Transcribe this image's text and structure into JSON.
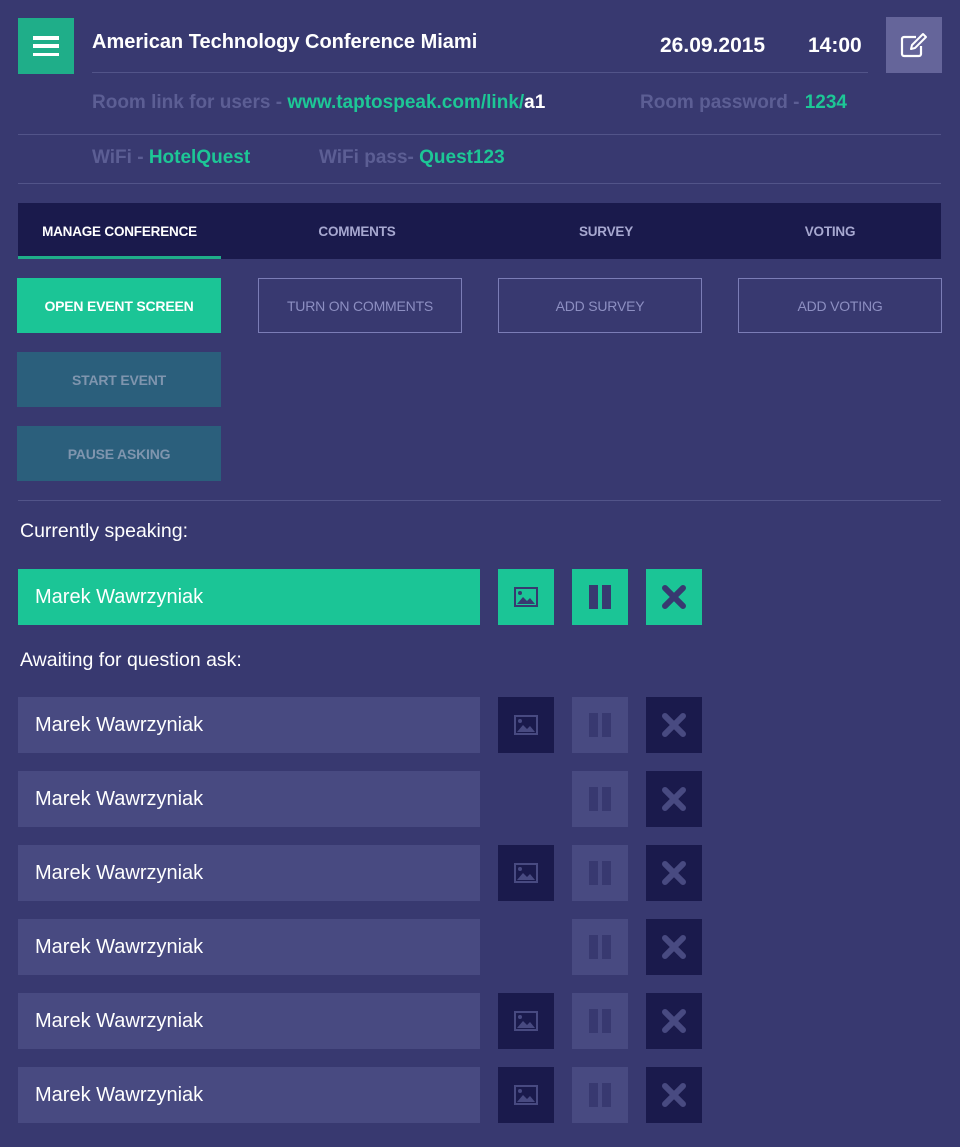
{
  "header": {
    "menu_icon": "hamburger-menu-icon",
    "title": "American Technology Conference Miami",
    "date": "26.09.2015",
    "time": "14:00",
    "edit_icon": "edit-pencil-icon"
  },
  "info": {
    "room_link_label": "Room link for users - ",
    "room_link_url": "www.taptospeak.com/link/",
    "room_link_suffix": "a1",
    "room_password_label": "Room password - ",
    "room_password_value": "1234",
    "wifi_label": "WiFi - ",
    "wifi_value": "HotelQuest",
    "wifi_pass_label": "WiFi pass- ",
    "wifi_pass_value": "Quest123"
  },
  "tabs": [
    {
      "label": "MANAGE CONFERENCE",
      "active": true
    },
    {
      "label": "COMMENTS",
      "active": false
    },
    {
      "label": "SURVEY",
      "active": false
    },
    {
      "label": "VOTING",
      "active": false
    }
  ],
  "actions": {
    "open_event_screen": "OPEN EVENT SCREEN",
    "turn_on_comments": "TURN ON COMMENTS",
    "add_survey": "ADD SURVEY",
    "add_voting": "ADD VOTING",
    "start_event": "START EVENT",
    "pause_asking": "PAUSE ASKING"
  },
  "currently_speaking": {
    "label": "Currently speaking:",
    "speaker": {
      "name": "Marek Wawrzyniak",
      "has_image": true
    }
  },
  "queue": {
    "label": "Awaiting for question ask:",
    "items": [
      {
        "name": "Marek Wawrzyniak",
        "has_image": true
      },
      {
        "name": "Marek Wawrzyniak",
        "has_image": false
      },
      {
        "name": "Marek Wawrzyniak",
        "has_image": true
      },
      {
        "name": "Marek Wawrzyniak",
        "has_image": false
      },
      {
        "name": "Marek Wawrzyniak",
        "has_image": true
      },
      {
        "name": "Marek Wawrzyniak",
        "has_image": true
      }
    ]
  },
  "icons": {
    "image": "image-icon",
    "pause": "pause-icon",
    "remove": "close-x-icon"
  },
  "colors": {
    "background": "#383970",
    "accent": "#1bc596",
    "dark": "#1a1a4c",
    "muted_text": "#5c5e94"
  }
}
